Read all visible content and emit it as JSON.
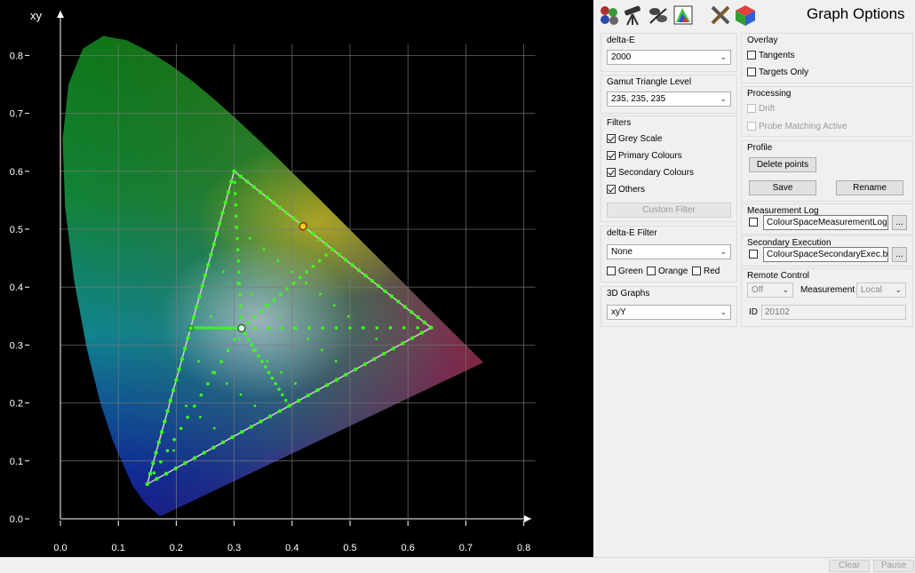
{
  "chart": {
    "axis_label": "xy",
    "x_ticks": [
      "0.0",
      "0.1",
      "0.2",
      "0.3",
      "0.4",
      "0.5",
      "0.6",
      "0.7",
      "0.8"
    ],
    "y_ticks": [
      "0.0",
      "0.1",
      "0.2",
      "0.3",
      "0.4",
      "0.5",
      "0.6",
      "0.7",
      "0.8"
    ],
    "xlim": [
      0,
      0.8
    ],
    "ylim": [
      0,
      0.8
    ],
    "gamut": {
      "red": [
        0.64,
        0.33
      ],
      "green": [
        0.3,
        0.6
      ],
      "blue": [
        0.15,
        0.06
      ],
      "white": [
        0.3127,
        0.329
      ]
    },
    "markers": [
      {
        "name": "white-point",
        "x": 0.3127,
        "y": 0.329
      },
      {
        "name": "yellow-marker",
        "x": 0.419,
        "y": 0.505
      },
      {
        "name": "grey-marker",
        "x": 0.225,
        "y": 0.329
      }
    ],
    "colors": {
      "points": "#39ff14",
      "triangle": "#d0d0d0",
      "grid": "#7a7a7a",
      "background": "#000000"
    }
  },
  "toolbar": {
    "icons": [
      "spheres-icon",
      "telescope-icon",
      "probe-icon",
      "color-chart-icon",
      "tools-icon",
      "cube-icon"
    ]
  },
  "panel": {
    "title": "Graph Options",
    "deltaE": {
      "label": "delta-E",
      "value": "2000"
    },
    "gamut_triangle": {
      "label": "Gamut Triangle Level",
      "value": "235, 235, 235"
    },
    "filters": {
      "label": "Filters",
      "grey_scale": "Grey Scale",
      "primary": "Primary Colours",
      "secondary": "Secondary Colours",
      "others": "Others",
      "custom_button": "Custom Filter"
    },
    "deltaE_filter": {
      "label": "delta-E Filter",
      "value": "None",
      "green": "Green",
      "orange": "Orange",
      "red": "Red"
    },
    "graphs3d": {
      "label": "3D Graphs",
      "value": "xyY"
    },
    "overlay": {
      "label": "Overlay",
      "tangents": "Tangents",
      "targets_only": "Targets Only"
    },
    "processing": {
      "label": "Processing",
      "drift": "Drift",
      "probe_matching": "Probe Matching Active"
    },
    "profile": {
      "label": "Profile",
      "delete": "Delete points",
      "save": "Save",
      "rename": "Rename"
    },
    "measurement_log": {
      "label": "Measurement Log",
      "file": "ColourSpaceMeasurementLog.csv",
      "browse": "..."
    },
    "secondary_exec": {
      "label": "Secondary Execution",
      "file": "ColourSpaceSecondaryExec.bat",
      "browse": "..."
    },
    "remote": {
      "label": "Remote Control",
      "mode": "Off",
      "measurement_label": "Measurement",
      "measurement": "Local",
      "id_label": "ID",
      "id": "20102"
    }
  },
  "status": {
    "clear": "Clear",
    "pause": "Pause"
  }
}
